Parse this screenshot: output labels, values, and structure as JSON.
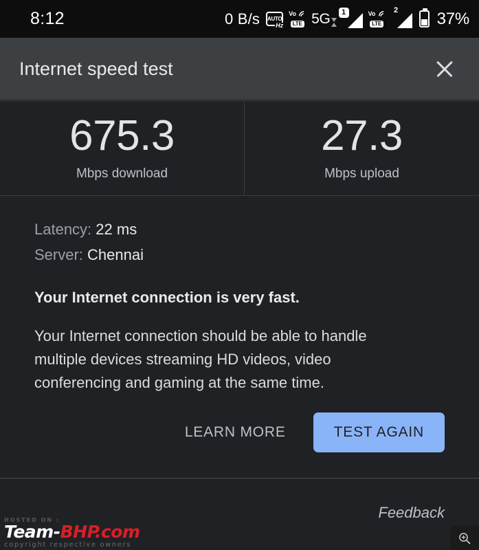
{
  "statusbar": {
    "clock": "8:12",
    "net_speed": "0 B/s",
    "refresh_rate_icon": {
      "label": "AUTO",
      "unit": "Hz"
    },
    "sim1": {
      "volte_label": "VoLTE",
      "lte_text": "LTE",
      "vo_text": "Vo",
      "network": "5G",
      "badge": "1"
    },
    "sim2": {
      "lte_text": "LTE",
      "vo_text": "Vo",
      "badge": "2"
    },
    "battery_percent": "37%"
  },
  "appbar": {
    "title": "Internet speed test",
    "close_label": "Close"
  },
  "speeds": [
    {
      "value": "675.3",
      "label": "Mbps download"
    },
    {
      "value": "27.3",
      "label": "Mbps upload"
    }
  ],
  "details": {
    "latency_label": "Latency:",
    "latency_value": "22 ms",
    "server_label": "Server:",
    "server_value": "Chennai"
  },
  "result": {
    "headline": "Your Internet connection is very fast.",
    "body": "Your Internet connection should be able to handle multiple devices streaming HD videos, video conferencing and gaming at the same time."
  },
  "actions": {
    "learn_more": "LEARN MORE",
    "test_again": "TEST AGAIN"
  },
  "footer": {
    "feedback": "Feedback"
  },
  "watermark": {
    "hosted": "HOSTED ON :",
    "brand_team": "Team-",
    "brand_bhp": "BHP",
    "brand_com": ".com",
    "copyright": "copyright respective owners"
  },
  "colors": {
    "accent_button": "#8ab4f8",
    "header_bg": "#3c4043",
    "page_bg": "#202124",
    "watermark_red": "#d81f26"
  }
}
